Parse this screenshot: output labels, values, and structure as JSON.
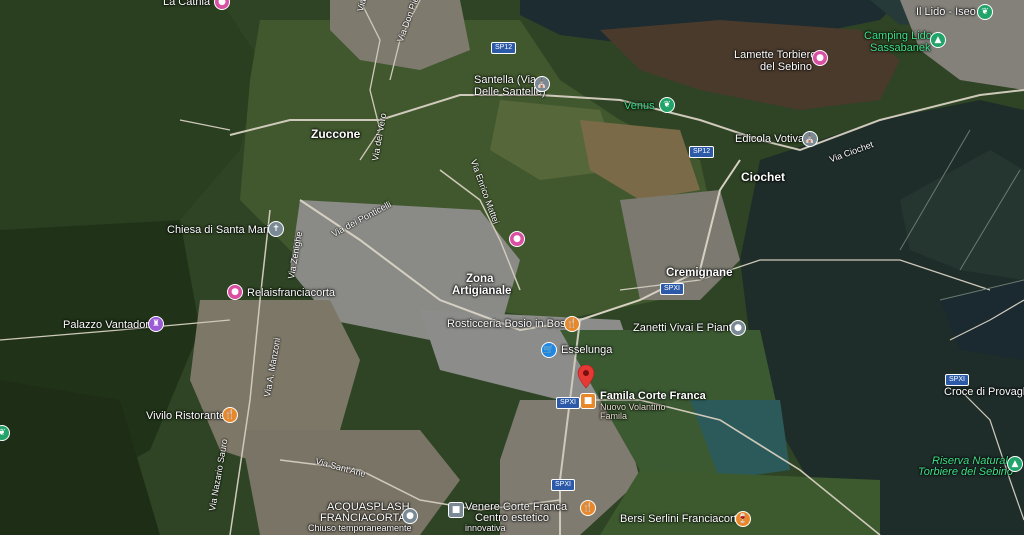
{
  "labels": {
    "la_cathia": "La Cathia",
    "il_lido": "Il Lido - Iseo",
    "camping_lido": "Camping Lido",
    "sassabanek": "Sassabanek",
    "lamette": "Lamette Torbiere",
    "lamette2": "del Sebino",
    "santella": "Santella (Via",
    "santella2": "Delle Santelle)",
    "venus": "Venus",
    "edicola": "Edicola Votiva",
    "zuccone": "Zuccone",
    "ciochet": "Ciochet",
    "chiesa": "Chiesa di Santa Maria",
    "zona": "Zona",
    "zona2": "Artigianale",
    "cremignane": "Cremignane",
    "relais": "Relaisfranciacorta",
    "palazzo": "Palazzo Vantadori",
    "rosticceria": "Rosticceria Bosio in Bosio",
    "zanetti": "Zanetti Vivai E Piante",
    "esselunga": "Esselunga",
    "famila": "Famila Corte Franca",
    "famila_sub": "Nuovo Volantino",
    "famila_sub2": "Famila",
    "vivilo": "Vivilo Ristorante",
    "croce": "Croce di Provaglio",
    "riserva": "Riserva Naturale",
    "riserva2": "Torbiere del Sebino",
    "acquasplash": "ACQUASPLASH",
    "acquasplash2": "FRANCIACORTA",
    "acquasplash3": "Chiuso temporaneamente",
    "venere": "Venere Corte Franca",
    "venere2": "Centro estetico",
    "venere3": "innovativa",
    "bersi": "Bersi Serlini Franciacorta"
  },
  "roads": {
    "via_luigi": "Via Luigi di G",
    "via_don": "Via Don Pietro",
    "via_del_vero": "Via del Vero",
    "via_enrico": "Via Enrico Mattei",
    "via_ciochet": "Via Ciochet",
    "via_pontirelli": "Via dei Ponticelli",
    "via_zenighe": "Via Zenighe",
    "via_manzoni": "Via A. Manzoni",
    "via_nazario": "Via Nazario Sauro",
    "via_sant": "Via Sant'Ane"
  },
  "shields": {
    "sp12a": "SP12",
    "sp12b": "SP12",
    "spxi_a": "SPXI",
    "spxi_b": "SPXI",
    "spxi_c": "SPXI",
    "spxi_d": "SPXI"
  },
  "colors": {
    "lake": "#1b2a2e",
    "forest": "#26381f",
    "field": "#3f5a2c",
    "urban": "#8a8780",
    "road": "#d9d4c8",
    "brand_red": "#e53935"
  },
  "icons": {
    "la_cathia": "pink-icon",
    "il_lido": "green-leaf-icon",
    "camping": "tent-icon",
    "lamette": "pink-icon",
    "santella": "church-icon",
    "venus": "green-leaf-icon",
    "edicola": "church-icon",
    "chiesa": "cross-icon",
    "zona": "pink-icon",
    "relais": "hotel-icon",
    "palazzo": "monument-icon",
    "rosticceria": "restaurant-icon",
    "zanetti": "shop-icon",
    "esselunga": "cart-icon",
    "famila": "store-icon",
    "vivilo": "restaurant-icon",
    "riserva": "park-icon",
    "acquasplash": "water-icon",
    "venere": "spa-icon",
    "bersi": "wine-icon"
  }
}
